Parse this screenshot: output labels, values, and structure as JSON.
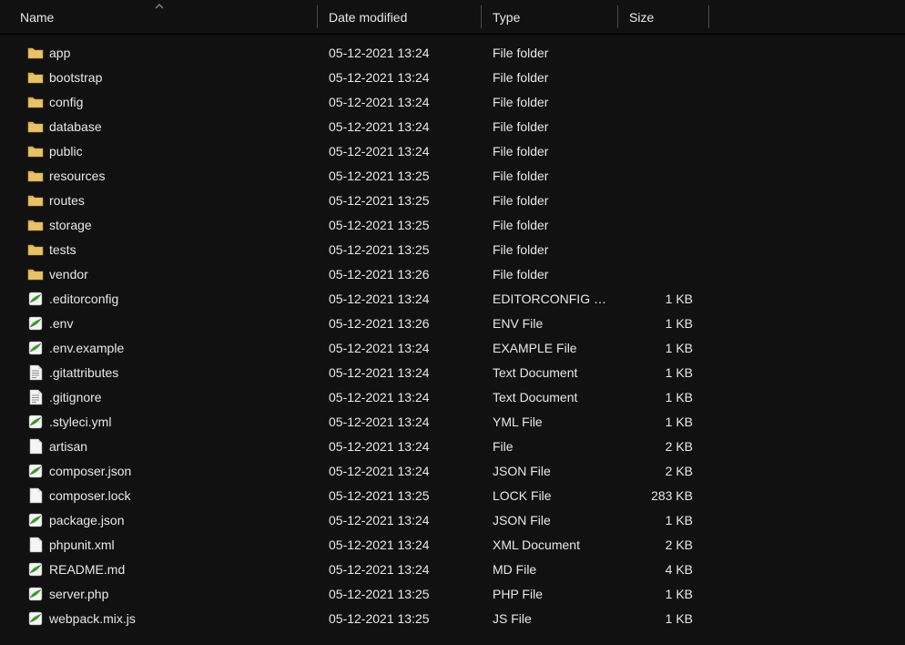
{
  "columns": {
    "name": "Name",
    "date": "Date modified",
    "type": "Type",
    "size": "Size"
  },
  "sort": {
    "column": "name",
    "direction": "asc"
  },
  "items": [
    {
      "icon": "folder",
      "name": "app",
      "date": "05-12-2021 13:24",
      "type": "File folder",
      "size": ""
    },
    {
      "icon": "folder",
      "name": "bootstrap",
      "date": "05-12-2021 13:24",
      "type": "File folder",
      "size": ""
    },
    {
      "icon": "folder",
      "name": "config",
      "date": "05-12-2021 13:24",
      "type": "File folder",
      "size": ""
    },
    {
      "icon": "folder",
      "name": "database",
      "date": "05-12-2021 13:24",
      "type": "File folder",
      "size": ""
    },
    {
      "icon": "folder",
      "name": "public",
      "date": "05-12-2021 13:24",
      "type": "File folder",
      "size": ""
    },
    {
      "icon": "folder",
      "name": "resources",
      "date": "05-12-2021 13:25",
      "type": "File folder",
      "size": ""
    },
    {
      "icon": "folder",
      "name": "routes",
      "date": "05-12-2021 13:25",
      "type": "File folder",
      "size": ""
    },
    {
      "icon": "folder",
      "name": "storage",
      "date": "05-12-2021 13:25",
      "type": "File folder",
      "size": ""
    },
    {
      "icon": "folder",
      "name": "tests",
      "date": "05-12-2021 13:25",
      "type": "File folder",
      "size": ""
    },
    {
      "icon": "folder",
      "name": "vendor",
      "date": "05-12-2021 13:26",
      "type": "File folder",
      "size": ""
    },
    {
      "icon": "np-green",
      "name": ".editorconfig",
      "date": "05-12-2021 13:24",
      "type": "EDITORCONFIG File",
      "size": "1 KB"
    },
    {
      "icon": "np-green",
      "name": ".env",
      "date": "05-12-2021 13:26",
      "type": "ENV File",
      "size": "1 KB"
    },
    {
      "icon": "np-green",
      "name": ".env.example",
      "date": "05-12-2021 13:24",
      "type": "EXAMPLE File",
      "size": "1 KB"
    },
    {
      "icon": "text-file",
      "name": ".gitattributes",
      "date": "05-12-2021 13:24",
      "type": "Text Document",
      "size": "1 KB"
    },
    {
      "icon": "text-file",
      "name": ".gitignore",
      "date": "05-12-2021 13:24",
      "type": "Text Document",
      "size": "1 KB"
    },
    {
      "icon": "np-green",
      "name": ".styleci.yml",
      "date": "05-12-2021 13:24",
      "type": "YML File",
      "size": "1 KB"
    },
    {
      "icon": "blank-file",
      "name": "artisan",
      "date": "05-12-2021 13:24",
      "type": "File",
      "size": "2 KB"
    },
    {
      "icon": "np-green",
      "name": "composer.json",
      "date": "05-12-2021 13:24",
      "type": "JSON File",
      "size": "2 KB"
    },
    {
      "icon": "blank-file",
      "name": "composer.lock",
      "date": "05-12-2021 13:25",
      "type": "LOCK File",
      "size": "283 KB"
    },
    {
      "icon": "np-green",
      "name": "package.json",
      "date": "05-12-2021 13:24",
      "type": "JSON File",
      "size": "1 KB"
    },
    {
      "icon": "blank-file",
      "name": "phpunit.xml",
      "date": "05-12-2021 13:24",
      "type": "XML Document",
      "size": "2 KB"
    },
    {
      "icon": "np-green",
      "name": "README.md",
      "date": "05-12-2021 13:24",
      "type": "MD File",
      "size": "4 KB"
    },
    {
      "icon": "np-green",
      "name": "server.php",
      "date": "05-12-2021 13:25",
      "type": "PHP File",
      "size": "1 KB"
    },
    {
      "icon": "np-green",
      "name": "webpack.mix.js",
      "date": "05-12-2021 13:25",
      "type": "JS File",
      "size": "1 KB"
    }
  ]
}
